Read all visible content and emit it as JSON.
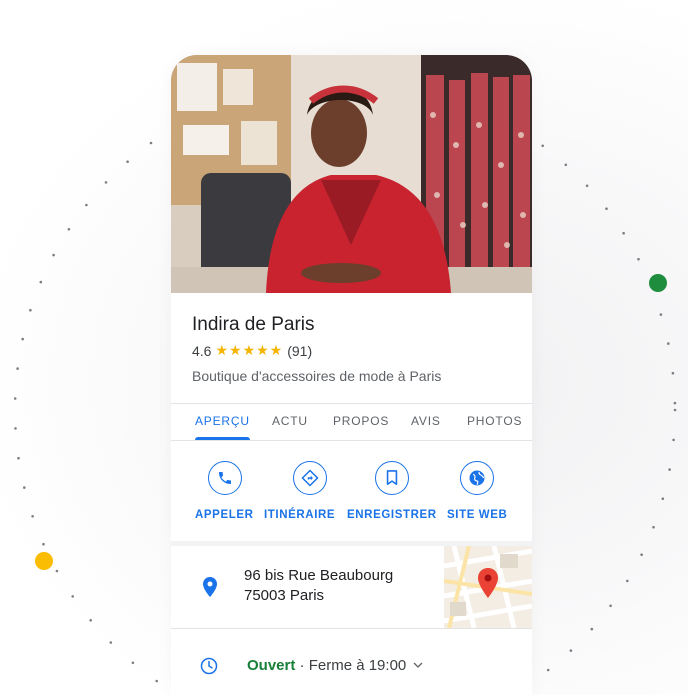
{
  "business": {
    "name": "Indira de Paris",
    "rating": "4.6",
    "stars": "★★★★★",
    "reviews": "(91)",
    "category": "Boutique d'accessoires de mode à Paris"
  },
  "tabs": [
    {
      "label": "APERÇU",
      "active": true
    },
    {
      "label": "ACTU",
      "active": false
    },
    {
      "label": "PROPOS",
      "active": false
    },
    {
      "label": "AVIS",
      "active": false
    },
    {
      "label": "PHOTOS",
      "active": false
    }
  ],
  "actions": [
    {
      "label": "APPELER",
      "icon": "phone-icon"
    },
    {
      "label": "ITINÉRAIRE",
      "icon": "directions-icon"
    },
    {
      "label": "ENREGISTRER",
      "icon": "bookmark-icon"
    },
    {
      "label": "SITE WEB",
      "icon": "globe-icon"
    }
  ],
  "address": {
    "line1": "96 bis Rue Beaubourg",
    "line2": "75003 Paris",
    "icon": "location-pin-icon"
  },
  "hours": {
    "status": "Ouvert",
    "separator": " · ",
    "closing": "Ferme à 19:00",
    "icon": "clock-icon"
  },
  "colors": {
    "accent": "#1a73e8",
    "star": "#f4b400",
    "open": "#188038",
    "dot_green": "#1e8e3e",
    "dot_yellow": "#fbbc04",
    "map_pin": "#ea4335"
  }
}
